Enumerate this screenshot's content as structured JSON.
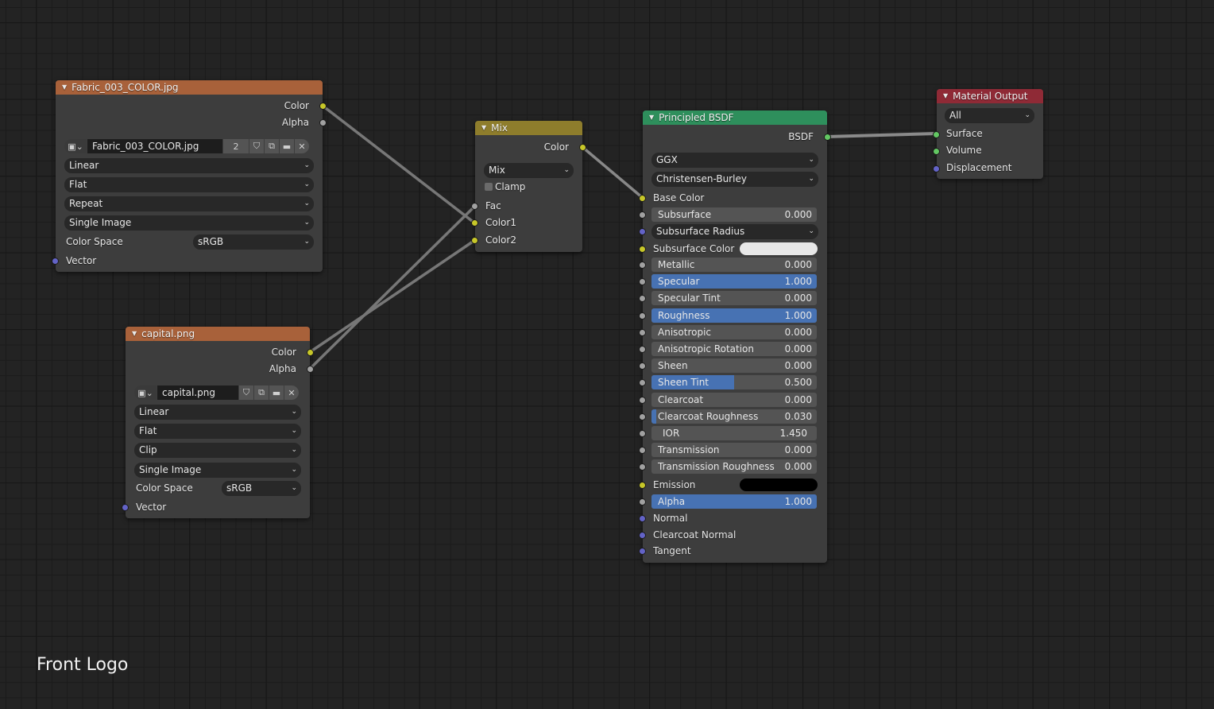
{
  "editor": {
    "frame_label": "Front Logo"
  },
  "nodes": {
    "fabric": {
      "title": "Fabric_003_COLOR.jpg",
      "header_color": "#a8613a",
      "outputs": [
        "Color",
        "Alpha"
      ],
      "image_name": "Fabric_003_COLOR.jpg",
      "users": "2",
      "interpolation": "Linear",
      "projection": "Flat",
      "extension": "Repeat",
      "source": "Single Image",
      "color_space_label": "Color Space",
      "color_space": "sRGB",
      "inputs": [
        "Vector"
      ]
    },
    "capital": {
      "title": "capital.png",
      "header_color": "#a8613a",
      "outputs": [
        "Color",
        "Alpha"
      ],
      "image_name": "capital.png",
      "interpolation": "Linear",
      "projection": "Flat",
      "extension": "Clip",
      "source": "Single Image",
      "color_space_label": "Color Space",
      "color_space": "sRGB",
      "inputs": [
        "Vector"
      ]
    },
    "mix": {
      "title": "Mix",
      "header_color": "#8e7d2c",
      "output": "Color",
      "blend_type": "Mix",
      "clamp_label": "Clamp",
      "clamp": false,
      "inputs": [
        "Fac",
        "Color1",
        "Color2"
      ]
    },
    "bsdf": {
      "title": "Principled BSDF",
      "header_color": "#2e8f5c",
      "output": "BSDF",
      "distribution": "GGX",
      "subsurface_method": "Christensen-Burley",
      "base_color_label": "Base Color",
      "subsurface_radius": "Subsurface Radius",
      "subsurface_color_label": "Subsurface Color",
      "subsurface_color": "#e8e8e8",
      "emission_label": "Emission",
      "emission_color": "#000000",
      "sliders": [
        {
          "label": "Subsurface",
          "value": "0.000",
          "fraction": 0
        },
        {
          "label": "Metallic",
          "value": "0.000",
          "fraction": 0
        },
        {
          "label": "Specular",
          "value": "1.000",
          "fraction": 1
        },
        {
          "label": "Specular Tint",
          "value": "0.000",
          "fraction": 0
        },
        {
          "label": "Roughness",
          "value": "1.000",
          "fraction": 1
        },
        {
          "label": "Anisotropic",
          "value": "0.000",
          "fraction": 0
        },
        {
          "label": "Anisotropic Rotation",
          "value": "0.000",
          "fraction": 0
        },
        {
          "label": "Sheen",
          "value": "0.000",
          "fraction": 0
        },
        {
          "label": "Sheen Tint",
          "value": "0.500",
          "fraction": 0.5
        },
        {
          "label": "Clearcoat",
          "value": "0.000",
          "fraction": 0
        },
        {
          "label": "Clearcoat Roughness",
          "value": "0.030",
          "fraction": 0.03
        },
        {
          "label": "IOR",
          "value": "1.450",
          "fraction": 0
        },
        {
          "label": "Transmission",
          "value": "0.000",
          "fraction": 0
        },
        {
          "label": "Transmission Roughness",
          "value": "0.000",
          "fraction": 0
        },
        {
          "label": "Alpha",
          "value": "1.000",
          "fraction": 1
        }
      ],
      "vector_inputs": [
        "Normal",
        "Clearcoat Normal",
        "Tangent"
      ]
    },
    "output": {
      "title": "Material Output",
      "header_color": "#8f2a36",
      "target": "All",
      "inputs": [
        "Surface",
        "Volume",
        "Displacement"
      ]
    }
  },
  "links": [
    {
      "from": "fabric.Color",
      "to": "mix.Color1"
    },
    {
      "from": "capital.Color",
      "to": "mix.Color2"
    },
    {
      "from": "capital.Alpha",
      "to": "mix.Fac"
    },
    {
      "from": "mix.Color",
      "to": "bsdf.Base Color"
    },
    {
      "from": "bsdf.BSDF",
      "to": "output.Surface"
    }
  ]
}
